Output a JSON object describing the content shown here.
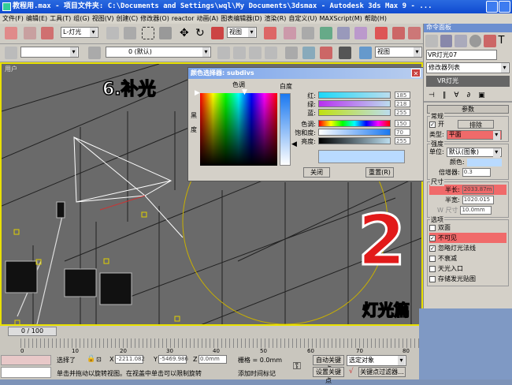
{
  "window": {
    "title": "教程用.max    - 项目文件夹: C:\\Documents and Settings\\wql\\My Documents\\3dsmax    - Autodesk 3ds Max 9    - ..."
  },
  "menu": [
    "文件(F)",
    "编辑(E)",
    "工具(T)",
    "组(G)",
    "视图(V)",
    "创建(C)",
    "修改器(O)",
    "reactor",
    "动画(A)",
    "图表编辑器(D)",
    "渲染(R)",
    "自定义(U)",
    "MAXScript(M)",
    "帮助(H)"
  ],
  "toolbar": {
    "selection_filter": "L-灯光",
    "ref_coord": "视图",
    "layer": "0 (默认)",
    "named_sel": "视图"
  },
  "viewport": {
    "label": "用户",
    "overlay_title": "6.补光",
    "overlay_number": "2",
    "overlay_caption": "灯光篇"
  },
  "color_picker": {
    "title": "颜色选择器: subdivs",
    "hue_label": "色调",
    "white_label": "白度",
    "black_label_1": "黑",
    "black_label_2": "度",
    "channels": [
      {
        "label": "红:",
        "value": "185"
      },
      {
        "label": "绿:",
        "value": "218"
      },
      {
        "label": "蓝:",
        "value": "255"
      },
      {
        "label": "色调:",
        "value": "150"
      },
      {
        "label": "饱和度:",
        "value": "70"
      },
      {
        "label": "亮度:",
        "value": "255"
      }
    ],
    "close_label": "关闭",
    "reset_label": "重置(R)",
    "preview_color": "#b9daff"
  },
  "command_panel": {
    "title": "命令面板",
    "object_name": "VR灯光07",
    "modifier_list": "修改器列表",
    "stack_item": "VR灯光",
    "rollout": "参数",
    "general": {
      "label": "常规",
      "on_label": "开",
      "exclude_label": "排除",
      "type_label": "类型:",
      "type_value": "平面"
    },
    "intensity": {
      "label": "强度",
      "units_label": "单位:",
      "units_value": "默认(图象)",
      "color_label": "颜色:",
      "mult_label": "倍增器:",
      "mult_value": "0.3",
      "color": "#b9daff"
    },
    "size": {
      "label": "尺寸",
      "half_length_label": "半长:",
      "half_length_value": "2033.87m",
      "half_width_label": "半宽:",
      "half_width_value": "1020.015",
      "w_size_label": "W 尺寸",
      "w_size_value": "10.0mm"
    },
    "options": {
      "label": "选项",
      "items": [
        {
          "label": "双面",
          "checked": false
        },
        {
          "label": "不可见",
          "checked": true
        },
        {
          "label": "忽略灯光法线",
          "checked": true
        },
        {
          "label": "不衰减",
          "checked": false
        },
        {
          "label": "天光入口",
          "checked": false
        },
        {
          "label": "存储发光贴图",
          "checked": false
        }
      ]
    }
  },
  "timeline": {
    "frame": "0 / 100",
    "ticks": [
      "0",
      "10",
      "20",
      "30",
      "40",
      "50",
      "60",
      "70",
      "80"
    ]
  },
  "status": {
    "selected": "选择了",
    "x_label": "X",
    "x": "-2211.082",
    "y_label": "Y",
    "y": "-5469.986",
    "z_label": "Z",
    "z": "0.0mm",
    "grid": "栅格 = 0.0mm",
    "auto_key": "自动关键点",
    "set_key": "设置关键点",
    "key_mode": "选定对象",
    "key_filters": "关键点过滤器...",
    "prompt": "单击并拖动以旋转视图。在视盖中单击可以限制旋转",
    "add_time_tag": "添加时间标记"
  }
}
